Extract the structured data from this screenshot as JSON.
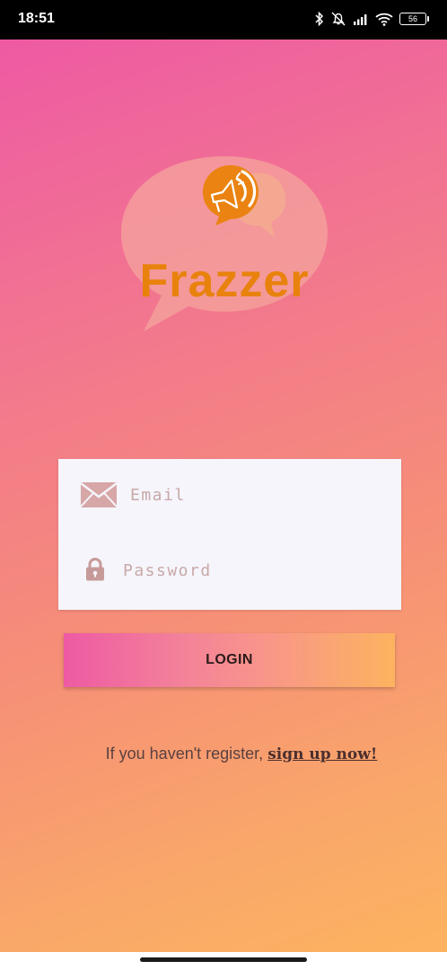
{
  "status_bar": {
    "time": "18:51",
    "battery_level": "56",
    "icons": [
      "bluetooth-icon",
      "mute-bell-icon",
      "signal-icon",
      "wifi-icon",
      "battery-icon"
    ]
  },
  "logo": {
    "text": "Frazzer",
    "colors": {
      "bubble": "#f2a39a",
      "accent_bubble": "#f7b96e",
      "brand": "#e8820c"
    }
  },
  "login_form": {
    "email_placeholder": "Email",
    "email_value": "",
    "password_placeholder": "Password",
    "password_value": ""
  },
  "login_button": {
    "label": "LOGIN"
  },
  "register": {
    "prompt": "If you haven't register, ",
    "link": "sign up now!"
  },
  "colors": {
    "gradient_start": "#ee5aa3",
    "gradient_end": "#fcb35f",
    "card_background": "#f5f5fb"
  }
}
